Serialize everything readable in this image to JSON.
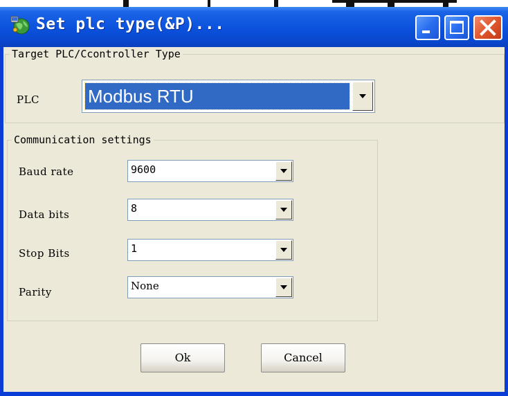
{
  "window": {
    "title": "Set plc type(&P)...",
    "title_gradient_color": "#0b51dc",
    "close_color": "#e0562e"
  },
  "target_group": {
    "title": "Target PLC/Ccontroller Type",
    "plc_label": "PLC",
    "plc_value": "Modbus RTU"
  },
  "comm_group": {
    "title": "Communication settings",
    "rows": [
      {
        "label": "Baud rate",
        "value": "9600"
      },
      {
        "label": "Data bits",
        "value": "8"
      },
      {
        "label": "Stop Bits",
        "value": "1"
      },
      {
        "label": "Parity",
        "value": "None"
      }
    ]
  },
  "buttons": {
    "ok": "Ok",
    "cancel": "Cancel"
  },
  "icons": {
    "app": "globe-network-icon",
    "minimize": "minimize-icon",
    "maximize": "maximize-icon",
    "close": "close-icon",
    "dropdown": "chevron-down-icon"
  }
}
